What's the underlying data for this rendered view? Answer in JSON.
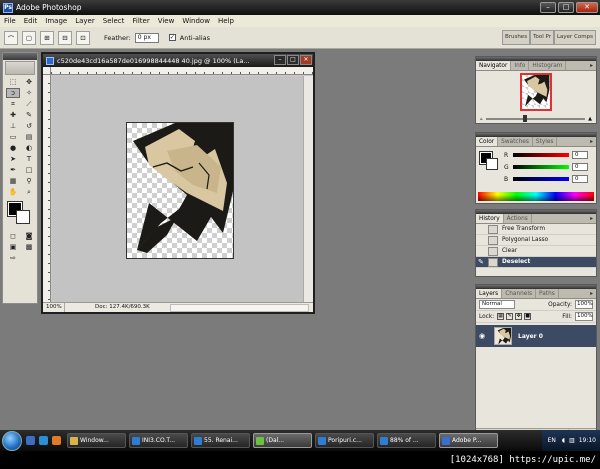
{
  "window": {
    "title": "Adobe Photoshop",
    "controls": [
      "minimize",
      "maximize",
      "close"
    ]
  },
  "menu": [
    "File",
    "Edit",
    "Image",
    "Layer",
    "Select",
    "Filter",
    "View",
    "Window",
    "Help"
  ],
  "options_bar": {
    "tool_icon": "lasso-icon",
    "feather_label": "Feather:",
    "feather_value": "0 px",
    "antialias_label": "Anti-alias",
    "antialias_checked": true,
    "palette_well_tabs": [
      "Brushes",
      "Tool Pr",
      "Layer Comps"
    ]
  },
  "toolbox": {
    "tools": [
      "marquee-icon",
      "move-icon",
      "lasso-icon",
      "magic-wand-icon",
      "crop-icon",
      "slice-icon",
      "healing-brush-icon",
      "brush-icon",
      "clone-stamp-icon",
      "history-brush-icon",
      "eraser-icon",
      "gradient-icon",
      "blur-icon",
      "dodge-icon",
      "path-selection-icon",
      "type-icon",
      "pen-icon",
      "shape-icon",
      "notes-icon",
      "eyedropper-icon",
      "hand-icon",
      "zoom-icon"
    ],
    "foreground_color": "#000000",
    "background_color": "#ffffff"
  },
  "document": {
    "title": "c520de43cd16a587de016998844448 40.jpg @ 100% (La...",
    "zoom": "100%",
    "doc_size": "Doc: 127.4K/690.3K"
  },
  "navigator": {
    "tabs": [
      "Navigator",
      "Info",
      "Histogram"
    ]
  },
  "color_panel": {
    "tabs": [
      "Color",
      "Swatches",
      "Styles"
    ],
    "channels": [
      {
        "label": "R",
        "value": "0",
        "color": "#e02020"
      },
      {
        "label": "G",
        "value": "0",
        "color": "#10b010"
      },
      {
        "label": "B",
        "value": "0",
        "color": "#1020d0"
      }
    ]
  },
  "history_panel": {
    "tabs": [
      "History",
      "Actions"
    ],
    "items": [
      {
        "label": "Free Transform",
        "selected": false
      },
      {
        "label": "Polygonal Lasso",
        "selected": false
      },
      {
        "label": "Clear",
        "selected": false
      },
      {
        "label": "Deselect",
        "selected": true
      }
    ]
  },
  "layers_panel": {
    "tabs": [
      "Layers",
      "Channels",
      "Paths"
    ],
    "blend_mode": "Normal",
    "opacity_label": "Opacity:",
    "opacity_value": "100%",
    "lock_label": "Lock:",
    "fill_label": "Fill:",
    "fill_value": "100%",
    "layers": [
      {
        "name": "Layer 0",
        "visible": true,
        "selected": true
      }
    ]
  },
  "taskbar": {
    "tasks": [
      {
        "label": "Window...",
        "color": "#d9b44a"
      },
      {
        "label": "INI3.CO.T...",
        "color": "#2f7dd3"
      },
      {
        "label": "55. Renai...",
        "color": "#2f7dd3"
      },
      {
        "label": "(Dal...",
        "color": "#6cbf3f",
        "active": true
      },
      {
        "label": "Poripuri.c...",
        "color": "#2f7dd3"
      },
      {
        "label": "88% of ...",
        "color": "#2f7dd3"
      },
      {
        "label": "Adobe P...",
        "color": "#3a6fd0",
        "active": true
      }
    ],
    "language": "EN",
    "time": "19:10"
  },
  "watermark": "[1024x768] https://upic.me/"
}
